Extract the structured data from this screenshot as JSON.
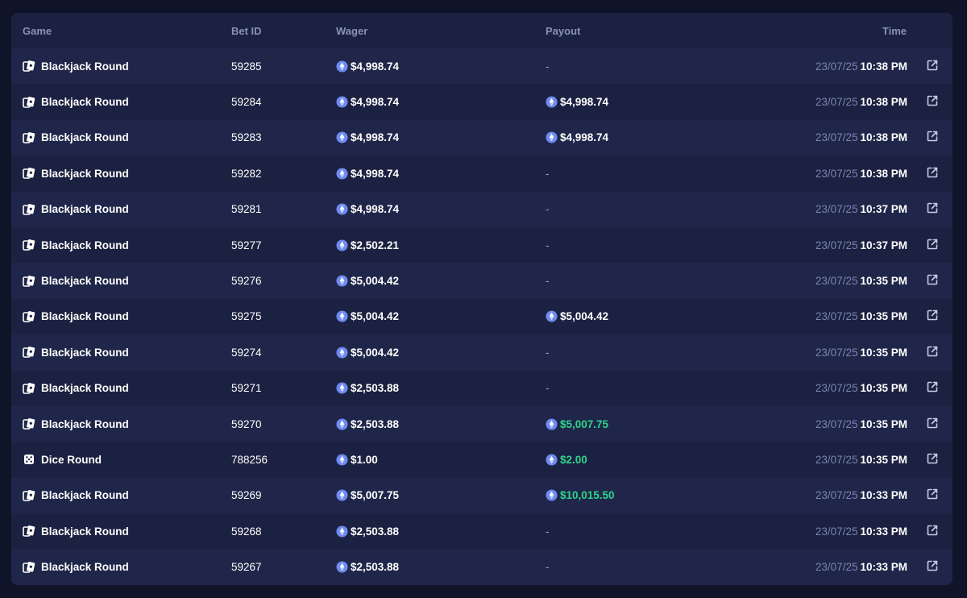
{
  "columns": {
    "game": "Game",
    "bet_id": "Bet ID",
    "wager": "Wager",
    "payout": "Payout",
    "time": "Time"
  },
  "colors": {
    "background": "#0f1429",
    "panel": "#1b2140",
    "row_alt": "#1f2649",
    "win": "#2fd48a",
    "coin": "#6f8bf2"
  },
  "rows": [
    {
      "game": "Blackjack Round",
      "icon": "cards-icon",
      "bet_id": "59285",
      "wager": "$4,998.74",
      "payout": "-",
      "payout_type": "none",
      "date": "23/07/25",
      "time": "10:38 PM"
    },
    {
      "game": "Blackjack Round",
      "icon": "cards-icon",
      "bet_id": "59284",
      "wager": "$4,998.74",
      "payout": "$4,998.74",
      "payout_type": "push",
      "date": "23/07/25",
      "time": "10:38 PM"
    },
    {
      "game": "Blackjack Round",
      "icon": "cards-icon",
      "bet_id": "59283",
      "wager": "$4,998.74",
      "payout": "$4,998.74",
      "payout_type": "push",
      "date": "23/07/25",
      "time": "10:38 PM"
    },
    {
      "game": "Blackjack Round",
      "icon": "cards-icon",
      "bet_id": "59282",
      "wager": "$4,998.74",
      "payout": "-",
      "payout_type": "none",
      "date": "23/07/25",
      "time": "10:38 PM"
    },
    {
      "game": "Blackjack Round",
      "icon": "cards-icon",
      "bet_id": "59281",
      "wager": "$4,998.74",
      "payout": "-",
      "payout_type": "none",
      "date": "23/07/25",
      "time": "10:37 PM"
    },
    {
      "game": "Blackjack Round",
      "icon": "cards-icon",
      "bet_id": "59277",
      "wager": "$2,502.21",
      "payout": "-",
      "payout_type": "none",
      "date": "23/07/25",
      "time": "10:37 PM"
    },
    {
      "game": "Blackjack Round",
      "icon": "cards-icon",
      "bet_id": "59276",
      "wager": "$5,004.42",
      "payout": "-",
      "payout_type": "none",
      "date": "23/07/25",
      "time": "10:35 PM"
    },
    {
      "game": "Blackjack Round",
      "icon": "cards-icon",
      "bet_id": "59275",
      "wager": "$5,004.42",
      "payout": "$5,004.42",
      "payout_type": "push",
      "date": "23/07/25",
      "time": "10:35 PM"
    },
    {
      "game": "Blackjack Round",
      "icon": "cards-icon",
      "bet_id": "59274",
      "wager": "$5,004.42",
      "payout": "-",
      "payout_type": "none",
      "date": "23/07/25",
      "time": "10:35 PM"
    },
    {
      "game": "Blackjack Round",
      "icon": "cards-icon",
      "bet_id": "59271",
      "wager": "$2,503.88",
      "payout": "-",
      "payout_type": "none",
      "date": "23/07/25",
      "time": "10:35 PM"
    },
    {
      "game": "Blackjack Round",
      "icon": "cards-icon",
      "bet_id": "59270",
      "wager": "$2,503.88",
      "payout": "$5,007.75",
      "payout_type": "win",
      "date": "23/07/25",
      "time": "10:35 PM"
    },
    {
      "game": "Dice Round",
      "icon": "dice-icon",
      "bet_id": "788256",
      "wager": "$1.00",
      "payout": "$2.00",
      "payout_type": "win",
      "date": "23/07/25",
      "time": "10:35 PM"
    },
    {
      "game": "Blackjack Round",
      "icon": "cards-icon",
      "bet_id": "59269",
      "wager": "$5,007.75",
      "payout": "$10,015.50",
      "payout_type": "win",
      "date": "23/07/25",
      "time": "10:33 PM"
    },
    {
      "game": "Blackjack Round",
      "icon": "cards-icon",
      "bet_id": "59268",
      "wager": "$2,503.88",
      "payout": "-",
      "payout_type": "none",
      "date": "23/07/25",
      "time": "10:33 PM"
    },
    {
      "game": "Blackjack Round",
      "icon": "cards-icon",
      "bet_id": "59267",
      "wager": "$2,503.88",
      "payout": "-",
      "payout_type": "none",
      "date": "23/07/25",
      "time": "10:33 PM"
    }
  ]
}
